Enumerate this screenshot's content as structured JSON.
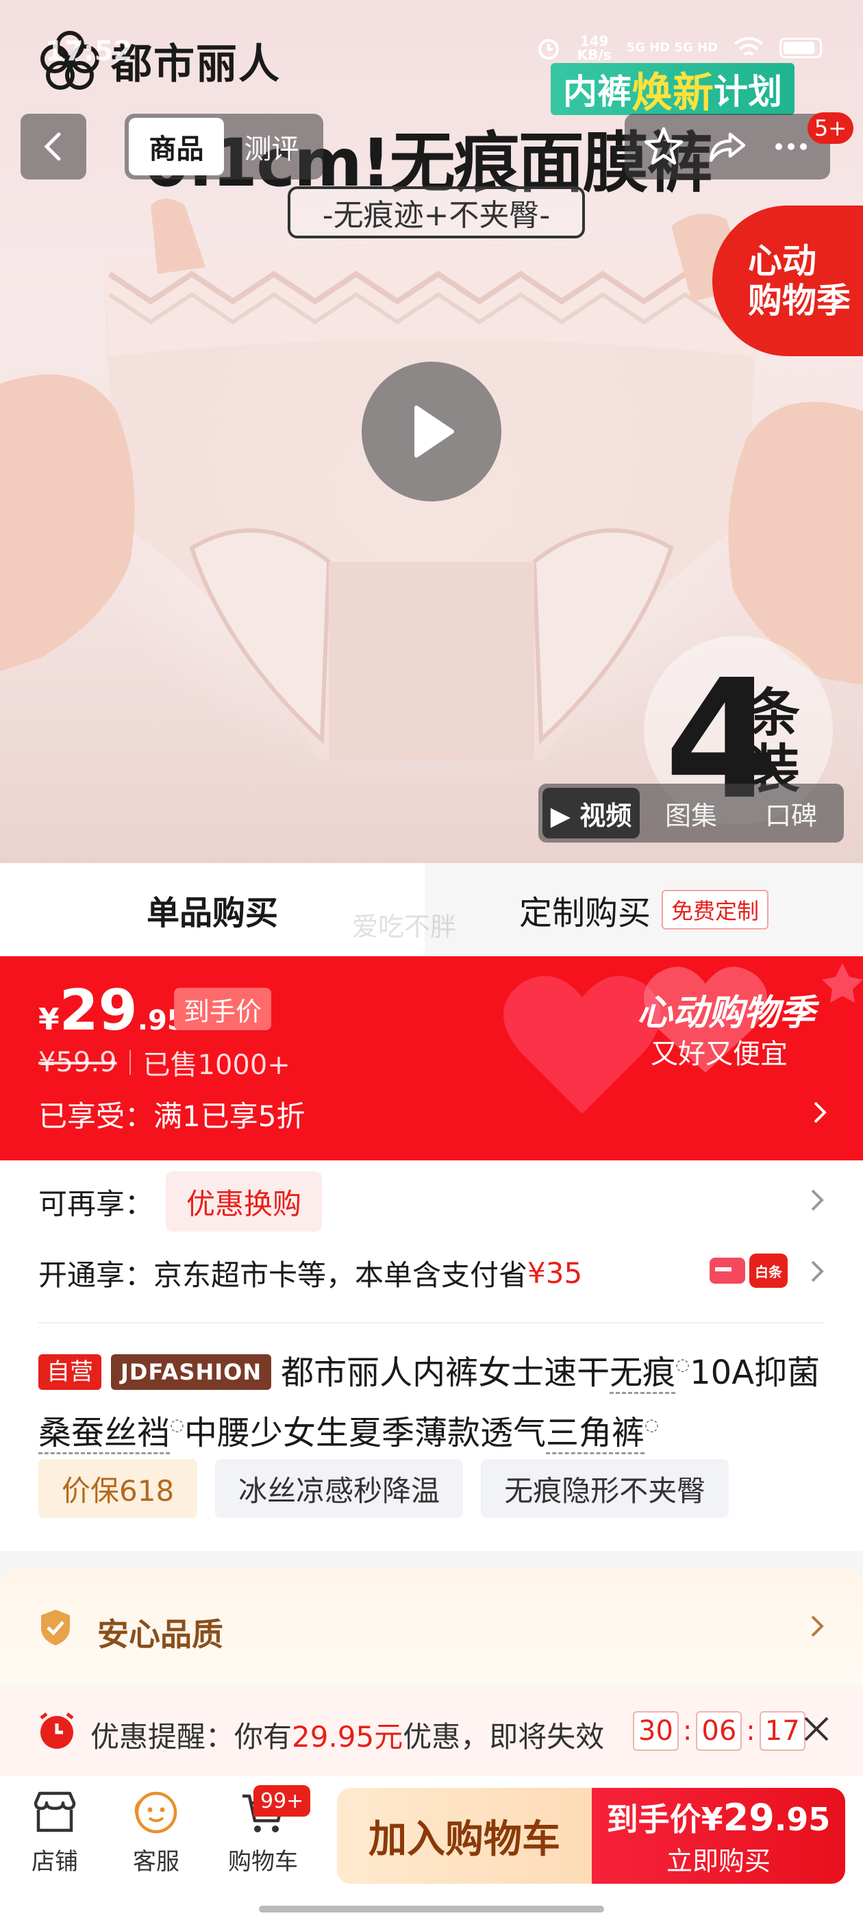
{
  "status_bar": {
    "time": "17:52",
    "speed_value": "149",
    "speed_unit": "KB/s",
    "network": "5G HD 5G HD"
  },
  "hero": {
    "brand": "都市丽人",
    "plan_prefix": "内裤",
    "plan_highlight": "焕新",
    "plan_suffix": "计划",
    "headline": "0.1cm!无痕面膜裤",
    "subheadline": "-无痕迹+不夹臀-",
    "promo_tag_line1": "心动",
    "promo_tag_line2": "购物季",
    "count": "4",
    "count_unit": "条装",
    "message_badge": "5+"
  },
  "nav": {
    "tabs": [
      {
        "label": "商品",
        "active": true
      },
      {
        "label": "测评",
        "active": false
      }
    ]
  },
  "media_tabs": [
    {
      "label": "▶ 视频",
      "active": true
    },
    {
      "label": "图集",
      "active": false
    },
    {
      "label": "口碑",
      "active": false
    }
  ],
  "buy_mode": {
    "single": "单品购买",
    "custom": "定制购买",
    "custom_chip": "免费定制",
    "watermark": "爱吃不胖"
  },
  "price": {
    "currency": "¥",
    "integer": "29",
    "decimal": ".95",
    "label": "到手价",
    "original": "¥59.9",
    "sold": "已售1000+",
    "discount": "已享受：满1已享5折",
    "festival_title": "心动购物季",
    "festival_sub": "又好又便宜"
  },
  "benefits": {
    "row1_label": "可再享：",
    "row1_chip": "优惠换购",
    "row2_text": "开通享：京东超市卡等，本单含支付省",
    "row2_amount": "¥35",
    "row2_icon_text": "白条"
  },
  "product": {
    "badge_self": "自营",
    "badge_brand": "JDFASHION",
    "title_1": "都市丽人内裤女士速干",
    "kw_1": "无痕",
    "title_2": "10A抑菌",
    "kw_2": "桑蚕丝裆",
    "title_3": "中腰少女生夏季薄款透气",
    "kw_3": "三角裤",
    "tags": [
      "价保618",
      "冰丝凉感秒降温",
      "无痕隐形不夹臀"
    ]
  },
  "quality": {
    "label": "安心品质"
  },
  "reminder": {
    "prefix": "优惠提醒：你有",
    "amount": "29.95元",
    "suffix": "优惠，即将失效",
    "hours": "30",
    "minutes": "06",
    "seconds": "17"
  },
  "bottom_bar": {
    "store": "店铺",
    "service": "客服",
    "cart": "购物车",
    "cart_badge": "99+",
    "add_to_cart": "加入购物车",
    "buy_price_label": "到手价¥",
    "buy_price_int": "29",
    "buy_price_dec": ".95",
    "buy_now": "立即购买"
  },
  "colors": {
    "brand_red": "#e8201a",
    "banner_red": "#f5121c",
    "gold": "#b26a1e"
  }
}
